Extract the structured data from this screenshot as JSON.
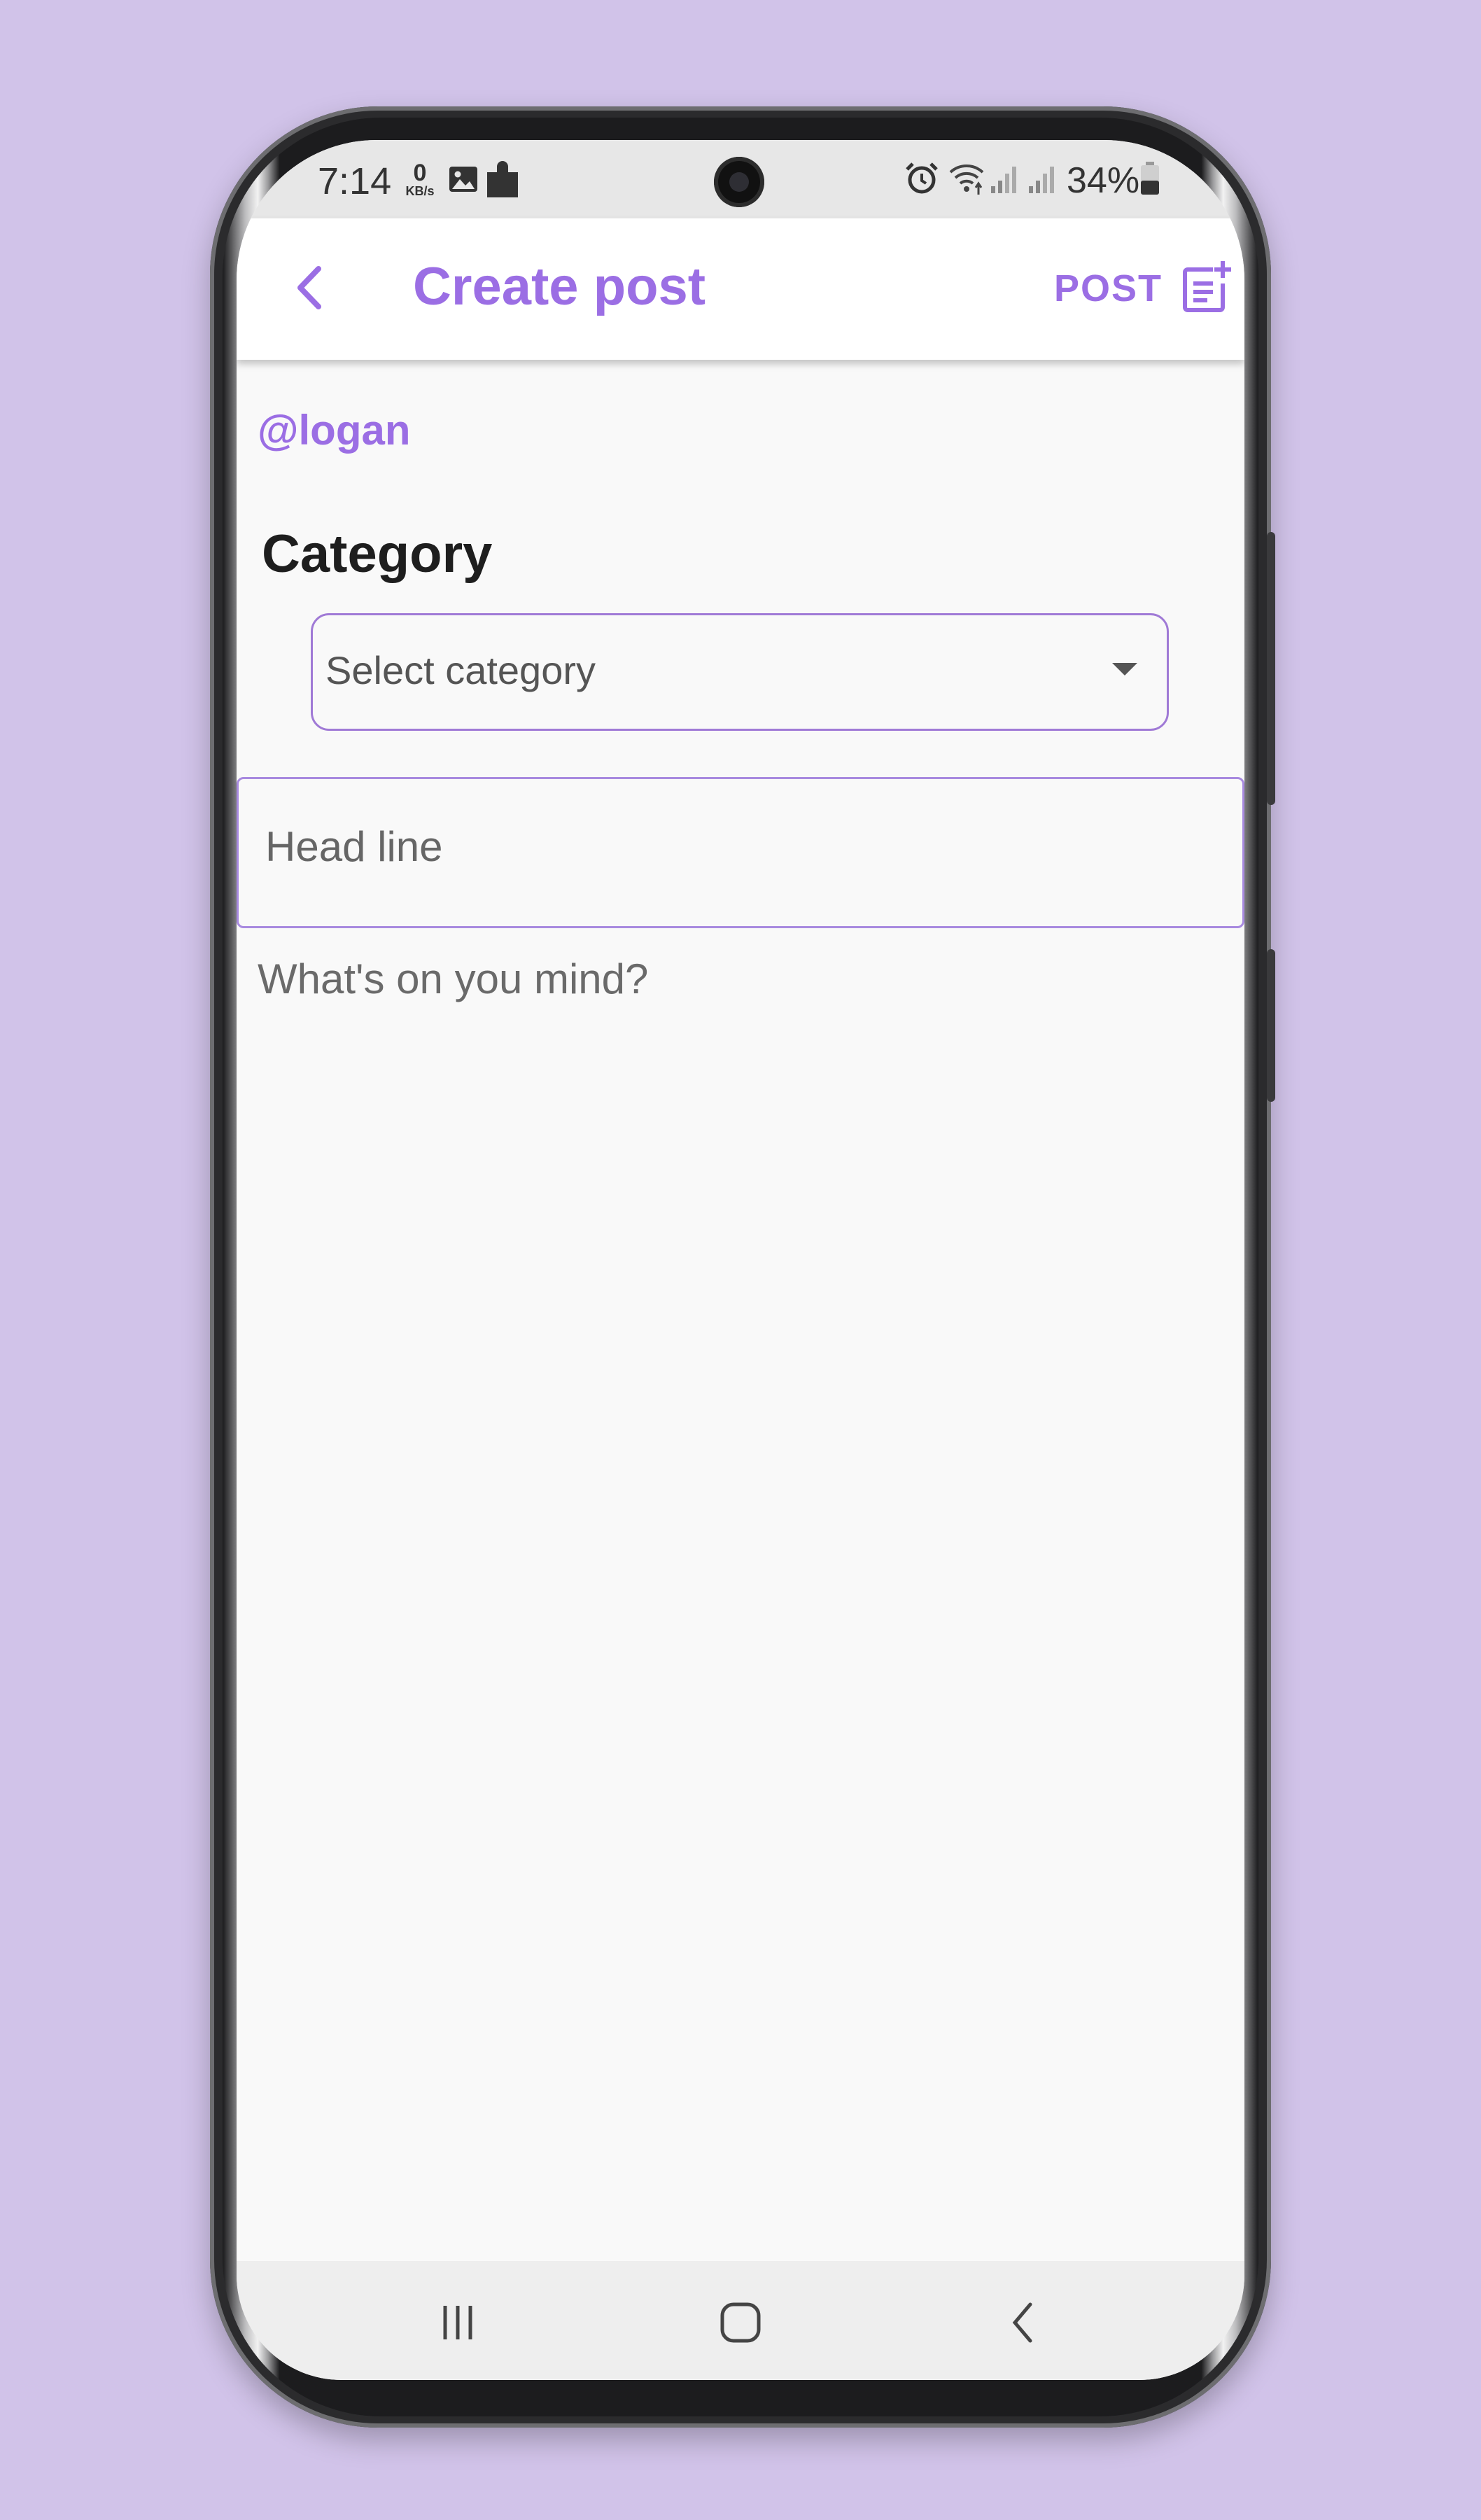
{
  "status_bar": {
    "time": "7:14",
    "net_speed_value": "0",
    "net_speed_unit": "KB/s",
    "battery": "34%",
    "icons": [
      "image-icon",
      "puzzle-icon",
      "alarm-icon",
      "wifi-icon",
      "signal-icon",
      "signal-icon",
      "battery-icon"
    ]
  },
  "app_bar": {
    "title": "Create post",
    "back_icon": "chevron-left-icon",
    "post_label": "POST",
    "post_icon": "post-add-icon"
  },
  "form": {
    "username": "@logan",
    "category_heading": "Category",
    "category_placeholder": "Select category",
    "headline_placeholder": "Head line",
    "body_placeholder": "What's on you mind?"
  },
  "nav_bar": {
    "recents_icon": "recents-icon",
    "home_icon": "home-icon",
    "back_icon": "back-icon"
  },
  "colors": {
    "accent": "#9b6ee4",
    "background": "#d1c3e9",
    "screen": "#f9f9f9"
  }
}
